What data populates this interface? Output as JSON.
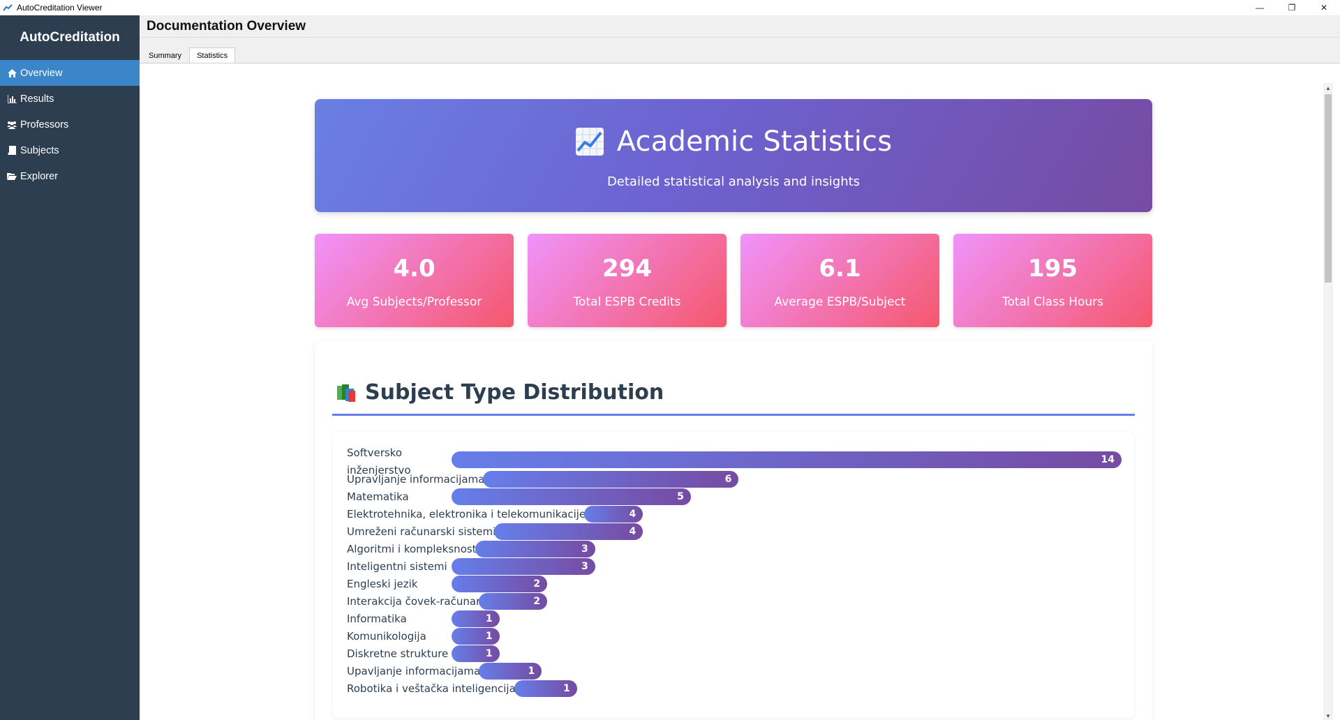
{
  "window": {
    "title": "AutoCreditation Viewer",
    "controls": [
      "—",
      "❐",
      "✕"
    ]
  },
  "sidebar": {
    "brand": "AutoCreditation",
    "items": [
      {
        "label": "Overview",
        "icon": "home-icon",
        "active": true
      },
      {
        "label": "Results",
        "icon": "bar-chart-icon",
        "active": false
      },
      {
        "label": "Professors",
        "icon": "users-icon",
        "active": false
      },
      {
        "label": "Subjects",
        "icon": "book-icon",
        "active": false
      },
      {
        "label": "Explorer",
        "icon": "folder-open-icon",
        "active": false
      }
    ]
  },
  "header": {
    "title": "Documentation Overview"
  },
  "tabs": [
    {
      "label": "Summary",
      "active": false
    },
    {
      "label": "Statistics",
      "active": true
    }
  ],
  "hero": {
    "title": "Academic Statistics",
    "subtitle": "Detailed statistical analysis and insights",
    "icon": "chart-increasing-icon"
  },
  "stats": [
    {
      "value": "4.0",
      "label": "Avg Subjects/Professor"
    },
    {
      "value": "294",
      "label": "Total ESPB Credits"
    },
    {
      "value": "6.1",
      "label": "Average ESPB/Subject"
    },
    {
      "value": "195",
      "label": "Total Class Hours"
    }
  ],
  "distribution": {
    "title": "Subject Type Distribution",
    "icon": "books-icon"
  },
  "chart_data": {
    "type": "bar",
    "orientation": "horizontal",
    "title": "Subject Type Distribution",
    "categories": [
      "Softversko inženjerstvo",
      "Upravljanje informacijama",
      "Matematika",
      "Elektrotehnika, elektronika i telekomunikacije",
      "Umreženi računarski sistemi",
      "Algoritmi i kompleksnost",
      "Inteligentni sistemi",
      "Engleski jezik",
      "Interakcija čovek-računar",
      "Informatika",
      "Komunikologija",
      "Diskretne strukture",
      "Upavljanje informacijama",
      "Robotika i veštačka inteligencija"
    ],
    "values": [
      14,
      6,
      5,
      4,
      4,
      3,
      3,
      2,
      2,
      1,
      1,
      1,
      1,
      1
    ],
    "colors": {
      "start": "#667eea",
      "end": "#764ba2"
    }
  }
}
